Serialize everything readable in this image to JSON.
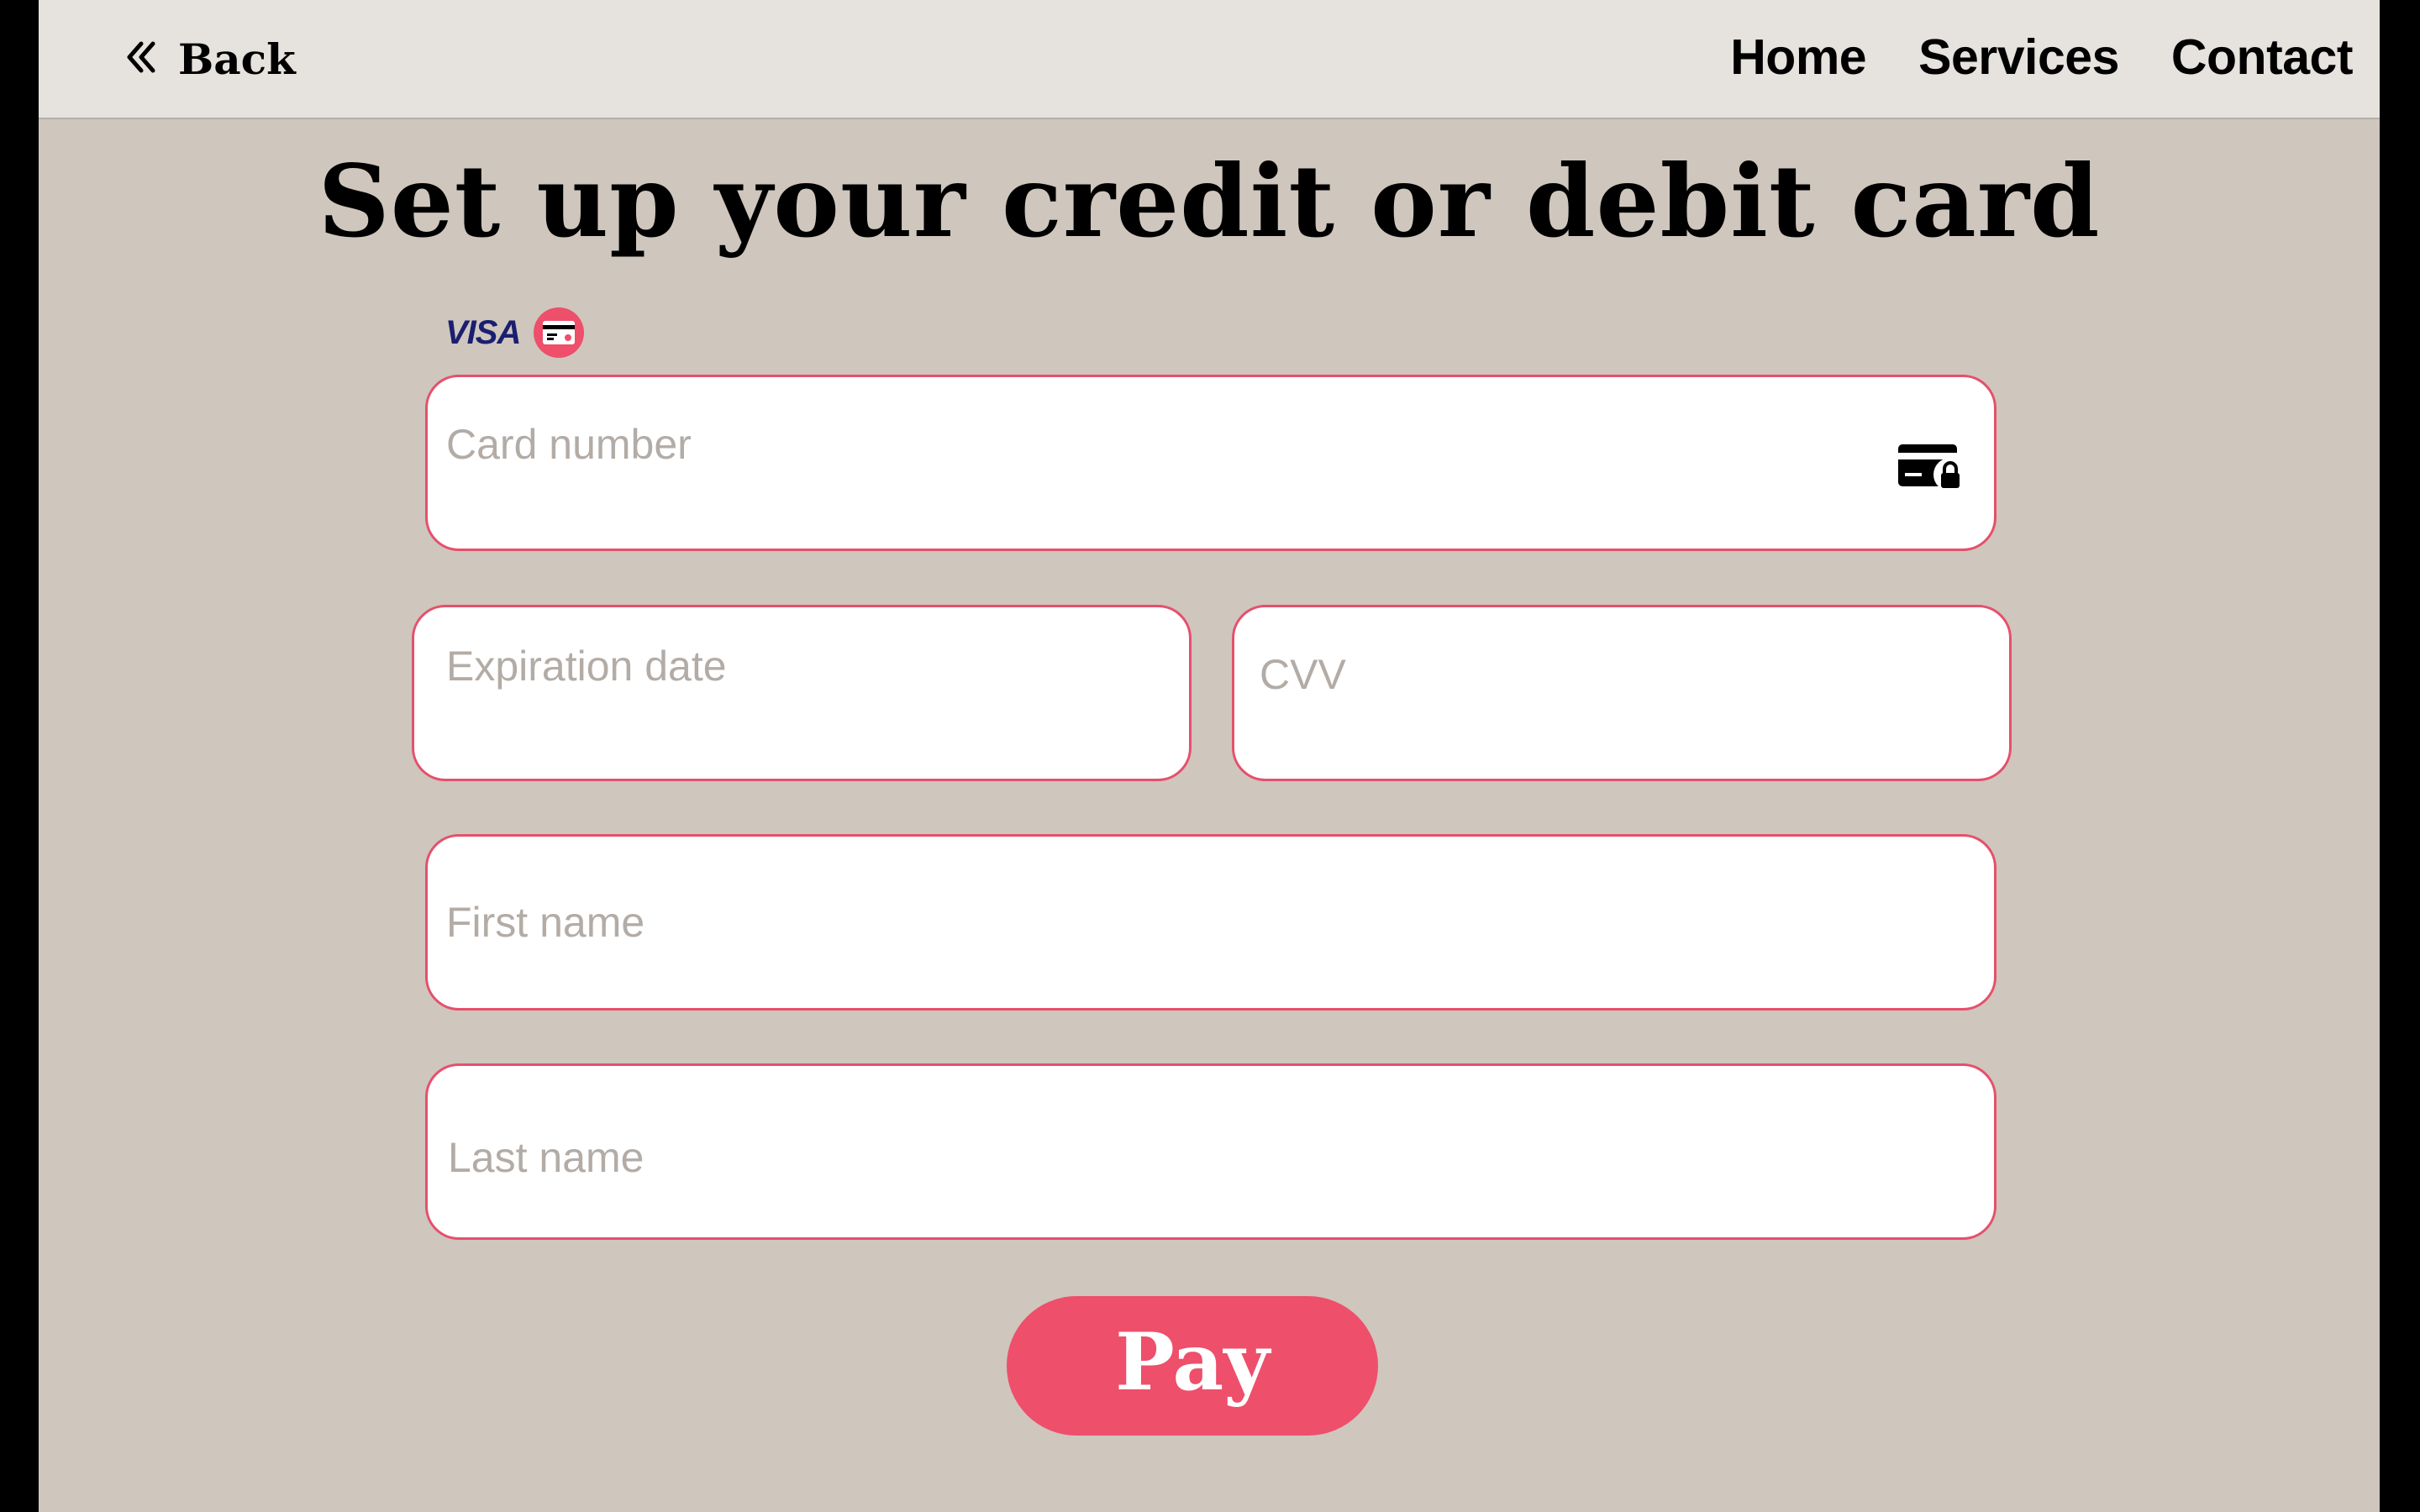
{
  "header": {
    "back_label": "Back",
    "nav": [
      "Home",
      "Services",
      "Contact"
    ]
  },
  "main": {
    "title": "Set up your credit or debit card",
    "brands": {
      "visa": "VISA"
    },
    "fields": {
      "card_number": {
        "placeholder": "Card number",
        "value": ""
      },
      "expiration_date": {
        "placeholder": "Expiration date",
        "value": ""
      },
      "cvv": {
        "placeholder": "CVV",
        "value": ""
      },
      "first_name": {
        "placeholder": "First name",
        "value": ""
      },
      "last_name": {
        "placeholder": "Last name",
        "value": ""
      }
    },
    "pay_label": "Pay"
  },
  "colors": {
    "accent": "#ee4f6b",
    "field_border": "#e5506c",
    "page_background": "#cfc6bd",
    "header_background": "#e6e2de",
    "placeholder_text": "#b3aca6",
    "visa_blue": "#1a1f71"
  },
  "icons": {
    "back": "double-chevron-left-icon",
    "brand_card": "credit-card-icon",
    "card_field": "card-lock-icon"
  }
}
